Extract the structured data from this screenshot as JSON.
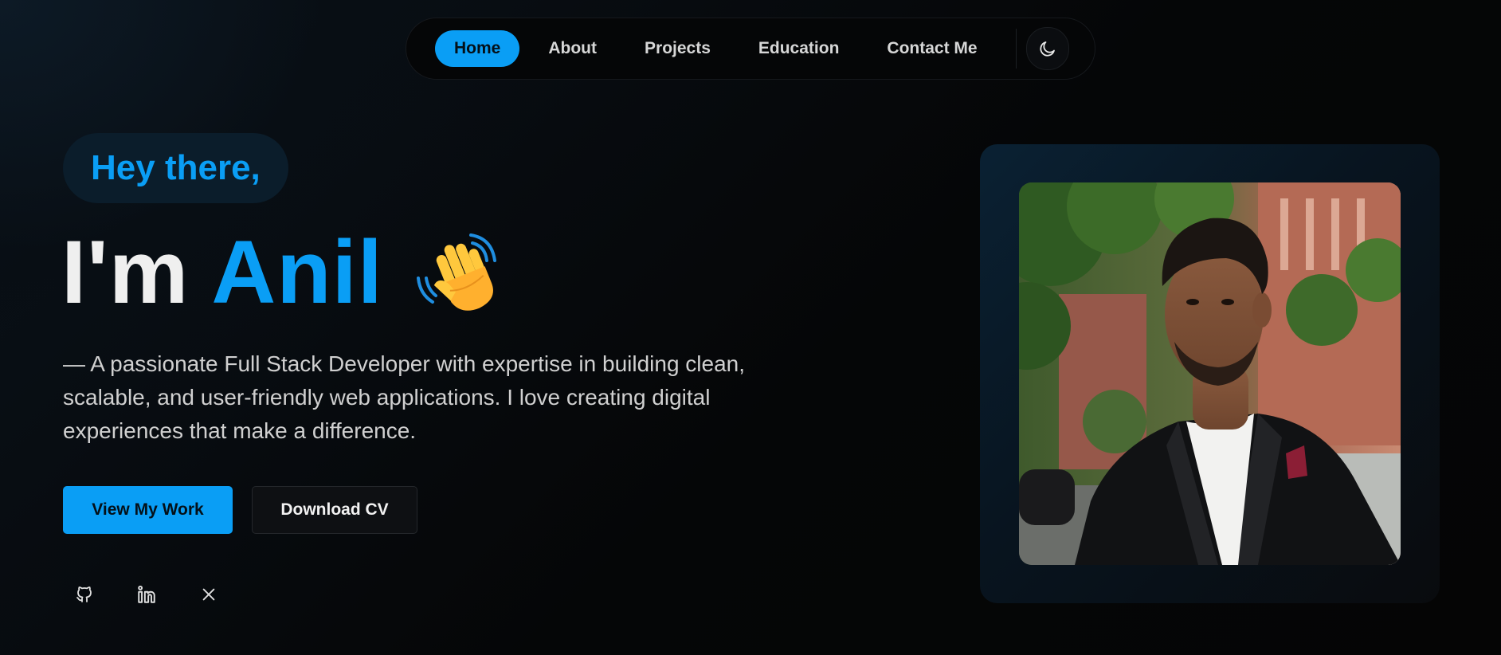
{
  "nav": {
    "links": [
      {
        "label": "Home",
        "active": true
      },
      {
        "label": "About",
        "active": false
      },
      {
        "label": "Projects",
        "active": false
      },
      {
        "label": "Education",
        "active": false
      },
      {
        "label": "Contact Me",
        "active": false
      }
    ],
    "theme_toggle_icon": "moon-icon"
  },
  "hero": {
    "greeting": "Hey there,",
    "headline_prefix": "I'm",
    "headline_name": "Anil",
    "wave_icon": "waving-hand-emoji",
    "bio": "— A passionate Full Stack Developer with expertise in building clean, scalable, and user-friendly web applications. I love creating digital experiences that make a difference.",
    "primary_button": "View My Work",
    "secondary_button": "Download CV",
    "socials": [
      {
        "icon": "github-icon"
      },
      {
        "icon": "linkedin-icon"
      },
      {
        "icon": "x-twitter-icon"
      }
    ]
  },
  "profile_photo": {
    "icon": "profile-photo"
  },
  "colors": {
    "accent": "#0a9ef5",
    "background": "#06080b",
    "text": "#e8e8e8"
  }
}
